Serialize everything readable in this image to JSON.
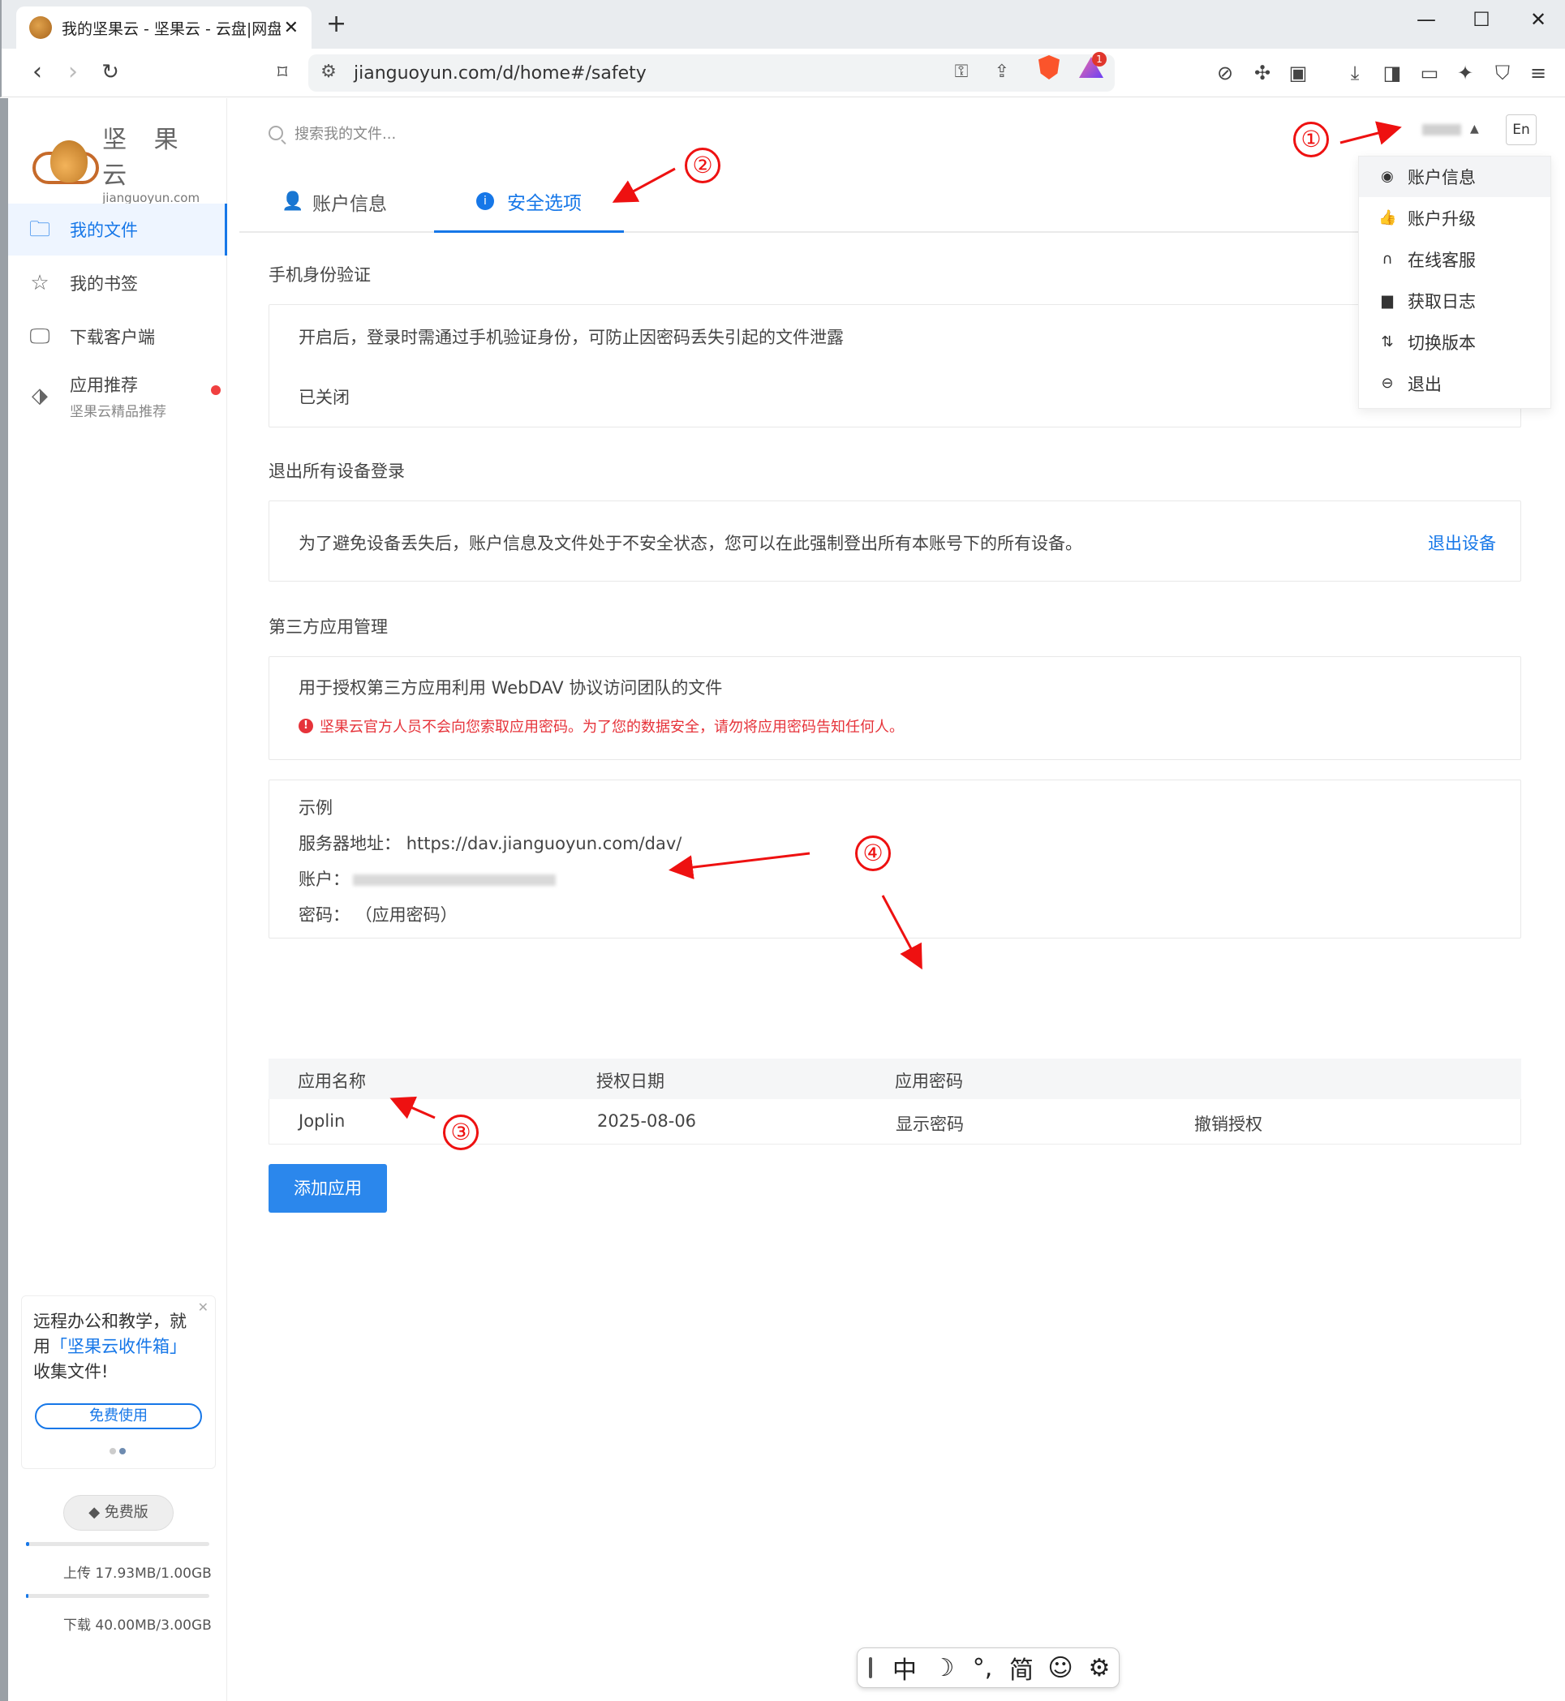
{
  "browser": {
    "tab_title": "我的坚果云 - 坚果云 - 云盘|网盘",
    "url": "jianguoyun.com/d/home#/safety",
    "reward_badge": "1"
  },
  "logo": {
    "cn": "坚 果 云",
    "en": "jianguoyun.com"
  },
  "sidebar": {
    "items": [
      {
        "label": "我的文件"
      },
      {
        "label": "我的书签"
      },
      {
        "label": "下载客户端"
      },
      {
        "label": "应用推荐",
        "sub": "坚果云精品推荐"
      }
    ],
    "promo": {
      "line1": "远程办公和教学，就",
      "line2_pre": "用",
      "line2_hl": "「坚果云收件箱」",
      "line3": "收集文件!",
      "button": "免费使用"
    },
    "plan": "免费版",
    "quota": {
      "upload_text": "上传 17.93MB/1.00GB",
      "download_text": "下载 40.00MB/3.00GB",
      "upload_fraction": 0.018,
      "download_fraction": 0.013
    }
  },
  "topbar": {
    "search_placeholder": "搜索我的文件...",
    "lang": "En"
  },
  "tabs": [
    {
      "label": "账户信息"
    },
    {
      "label": "安全选项"
    }
  ],
  "sections": {
    "phone": {
      "title": "手机身份验证",
      "desc": "开启后，登录时需通过手机验证身份，可防止因密码丢失引起的文件泄露",
      "status": "已关闭"
    },
    "logout": {
      "title": "退出所有设备登录",
      "desc": "为了避免设备丢失后，账户信息及文件处于不安全状态，您可以在此强制登出所有本账号下的所有设备。",
      "action": "退出设备"
    },
    "thirdparty": {
      "title": "第三方应用管理",
      "desc": "用于授权第三方应用利用 WebDAV 协议访问团队的文件",
      "warning": "坚果云官方人员不会向您索取应用密码。为了您的数据安全，请勿将应用密码告知任何人。",
      "example_title": "示例",
      "server_label": "服务器地址：",
      "server_value": "https://dav.jianguoyun.com/dav/",
      "account_label": "账户：",
      "password_label": "密码：",
      "password_value": "（应用密码）"
    }
  },
  "table": {
    "headers": [
      "应用名称",
      "授权日期",
      "应用密码"
    ],
    "rows": [
      {
        "name": "Joplin",
        "date": "2025-08-06",
        "show": "显示密码",
        "revoke": "撤销授权"
      }
    ]
  },
  "add_button": "添加应用",
  "dropdown": [
    {
      "label": "账户信息",
      "icon": "user-circle-icon"
    },
    {
      "label": "账户升级",
      "icon": "thumbs-up-icon"
    },
    {
      "label": "在线客服",
      "icon": "headset-icon"
    },
    {
      "label": "获取日志",
      "icon": "log-icon"
    },
    {
      "label": "切换版本",
      "icon": "switch-icon"
    },
    {
      "label": "退出",
      "icon": "logout-icon"
    }
  ],
  "annotations": [
    "①",
    "②",
    "③",
    "④"
  ],
  "ime": {
    "mode": "中",
    "moon": "☽",
    "punct": "°,",
    "script": "简",
    "emoji": "☺",
    "settings": "⚙"
  },
  "colors": {
    "accent": "#1677e8",
    "warning": "#e6333a",
    "annotation": "#e11111"
  }
}
